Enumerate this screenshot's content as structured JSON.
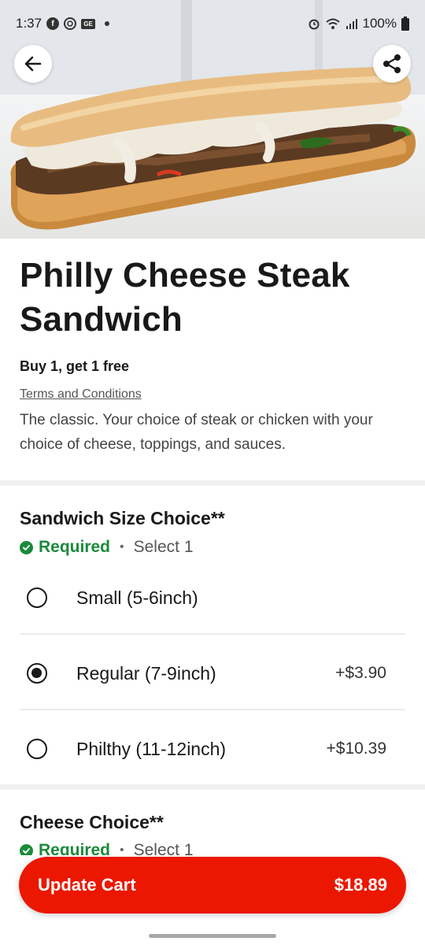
{
  "status_bar": {
    "time": "1:37",
    "icons_left": [
      "facebook-icon",
      "threads-icon",
      "ge-icon",
      "dot-icon"
    ],
    "icons_right": [
      "alarm-icon",
      "wifi-icon",
      "signal-icon",
      "battery-icon"
    ],
    "battery": "100%",
    "ge_label": "GE",
    "facebook_letter": "f"
  },
  "header": {
    "back_icon": "arrow-left-icon",
    "share_icon": "share-icon"
  },
  "item": {
    "title": "Philly Cheese Steak Sandwich",
    "promo": "Buy 1, get 1 free",
    "terms_link": "Terms and Conditions",
    "description": "The classic. Your choice of steak or chicken with your choice of cheese, toppings, and sauces."
  },
  "size_section": {
    "title": "Sandwich Size Choice**",
    "required_label": "Required",
    "separator": "•",
    "select_label": "Select 1",
    "options": [
      {
        "label": "Small (5-6inch)",
        "price": "",
        "selected": false
      },
      {
        "label": "Regular (7-9inch)",
        "price": "+$3.90",
        "selected": true
      },
      {
        "label": "Philthy (11-12inch)",
        "price": "+$10.39",
        "selected": false
      }
    ]
  },
  "cheese_section": {
    "title": "Cheese Choice**",
    "required_label": "Required",
    "separator": "•",
    "select_label": "Select 1"
  },
  "cart": {
    "label": "Update Cart",
    "total": "$18.89"
  },
  "colors": {
    "accent": "#eb1700",
    "required_green": "#1a8a3a"
  }
}
